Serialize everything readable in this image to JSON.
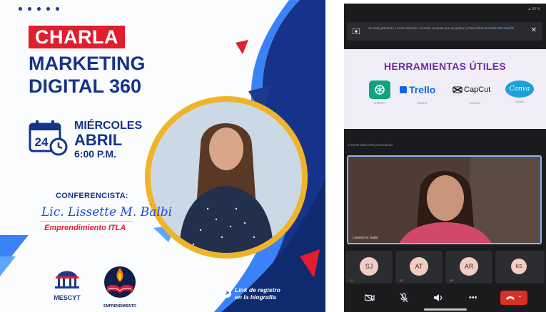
{
  "poster": {
    "badge": "CHARLA",
    "title_line1": "MARKETING",
    "title_line2": "DIGITAL 360",
    "date": {
      "day_number": "24",
      "weekday": "MIÉRCOLES",
      "month": "ABRIL",
      "time": "6:00 P.M."
    },
    "speaker_label": "CONFERENCISTA:",
    "speaker_signature": "Lic. Lissette M. Balbi",
    "organization": "Emprendimiento ITLA",
    "logos": {
      "mescyt": "MESCYT",
      "emprendimiento": "EMPRENDIMIENTO"
    },
    "registration_line1": "Link de registro",
    "registration_line2": "en la biografía",
    "colors": {
      "brand_blue": "#16338a",
      "accent_red": "#e11d2e",
      "accent_gold": "#f0b429"
    }
  },
  "meeting": {
    "status_bar": "▲ 96 %",
    "notice_text": "Se está grabando y transcribiendo. Al unirte, aceptas que se graben y transcriban tus",
    "notice_link": "Más información",
    "slide": {
      "title": "HERRAMIENTAS ÚTILES",
      "tools": [
        {
          "name": "ChatGPT",
          "caption": "CHATGPT"
        },
        {
          "name": "Trello",
          "caption": "TRELLO"
        },
        {
          "name": "CapCut",
          "caption": "CAPCUT"
        },
        {
          "name": "Canva",
          "caption": "CANVA"
        }
      ]
    },
    "presentation_info": "Lissette Balbi está presentando",
    "active_speaker_name": "Lissette M. Balbi",
    "participants": [
      {
        "initials": "SJ",
        "name": "SJ"
      },
      {
        "initials": "AT",
        "name": "AT"
      },
      {
        "initials": "AR",
        "name": "AR"
      },
      {
        "initials": "KS",
        "name": "KS"
      }
    ],
    "icons": {
      "camera": "camera-off-icon",
      "mic": "mic-off-icon",
      "speaker": "speaker-icon",
      "more": "more-options-icon",
      "end_call": "end-call-icon"
    }
  }
}
